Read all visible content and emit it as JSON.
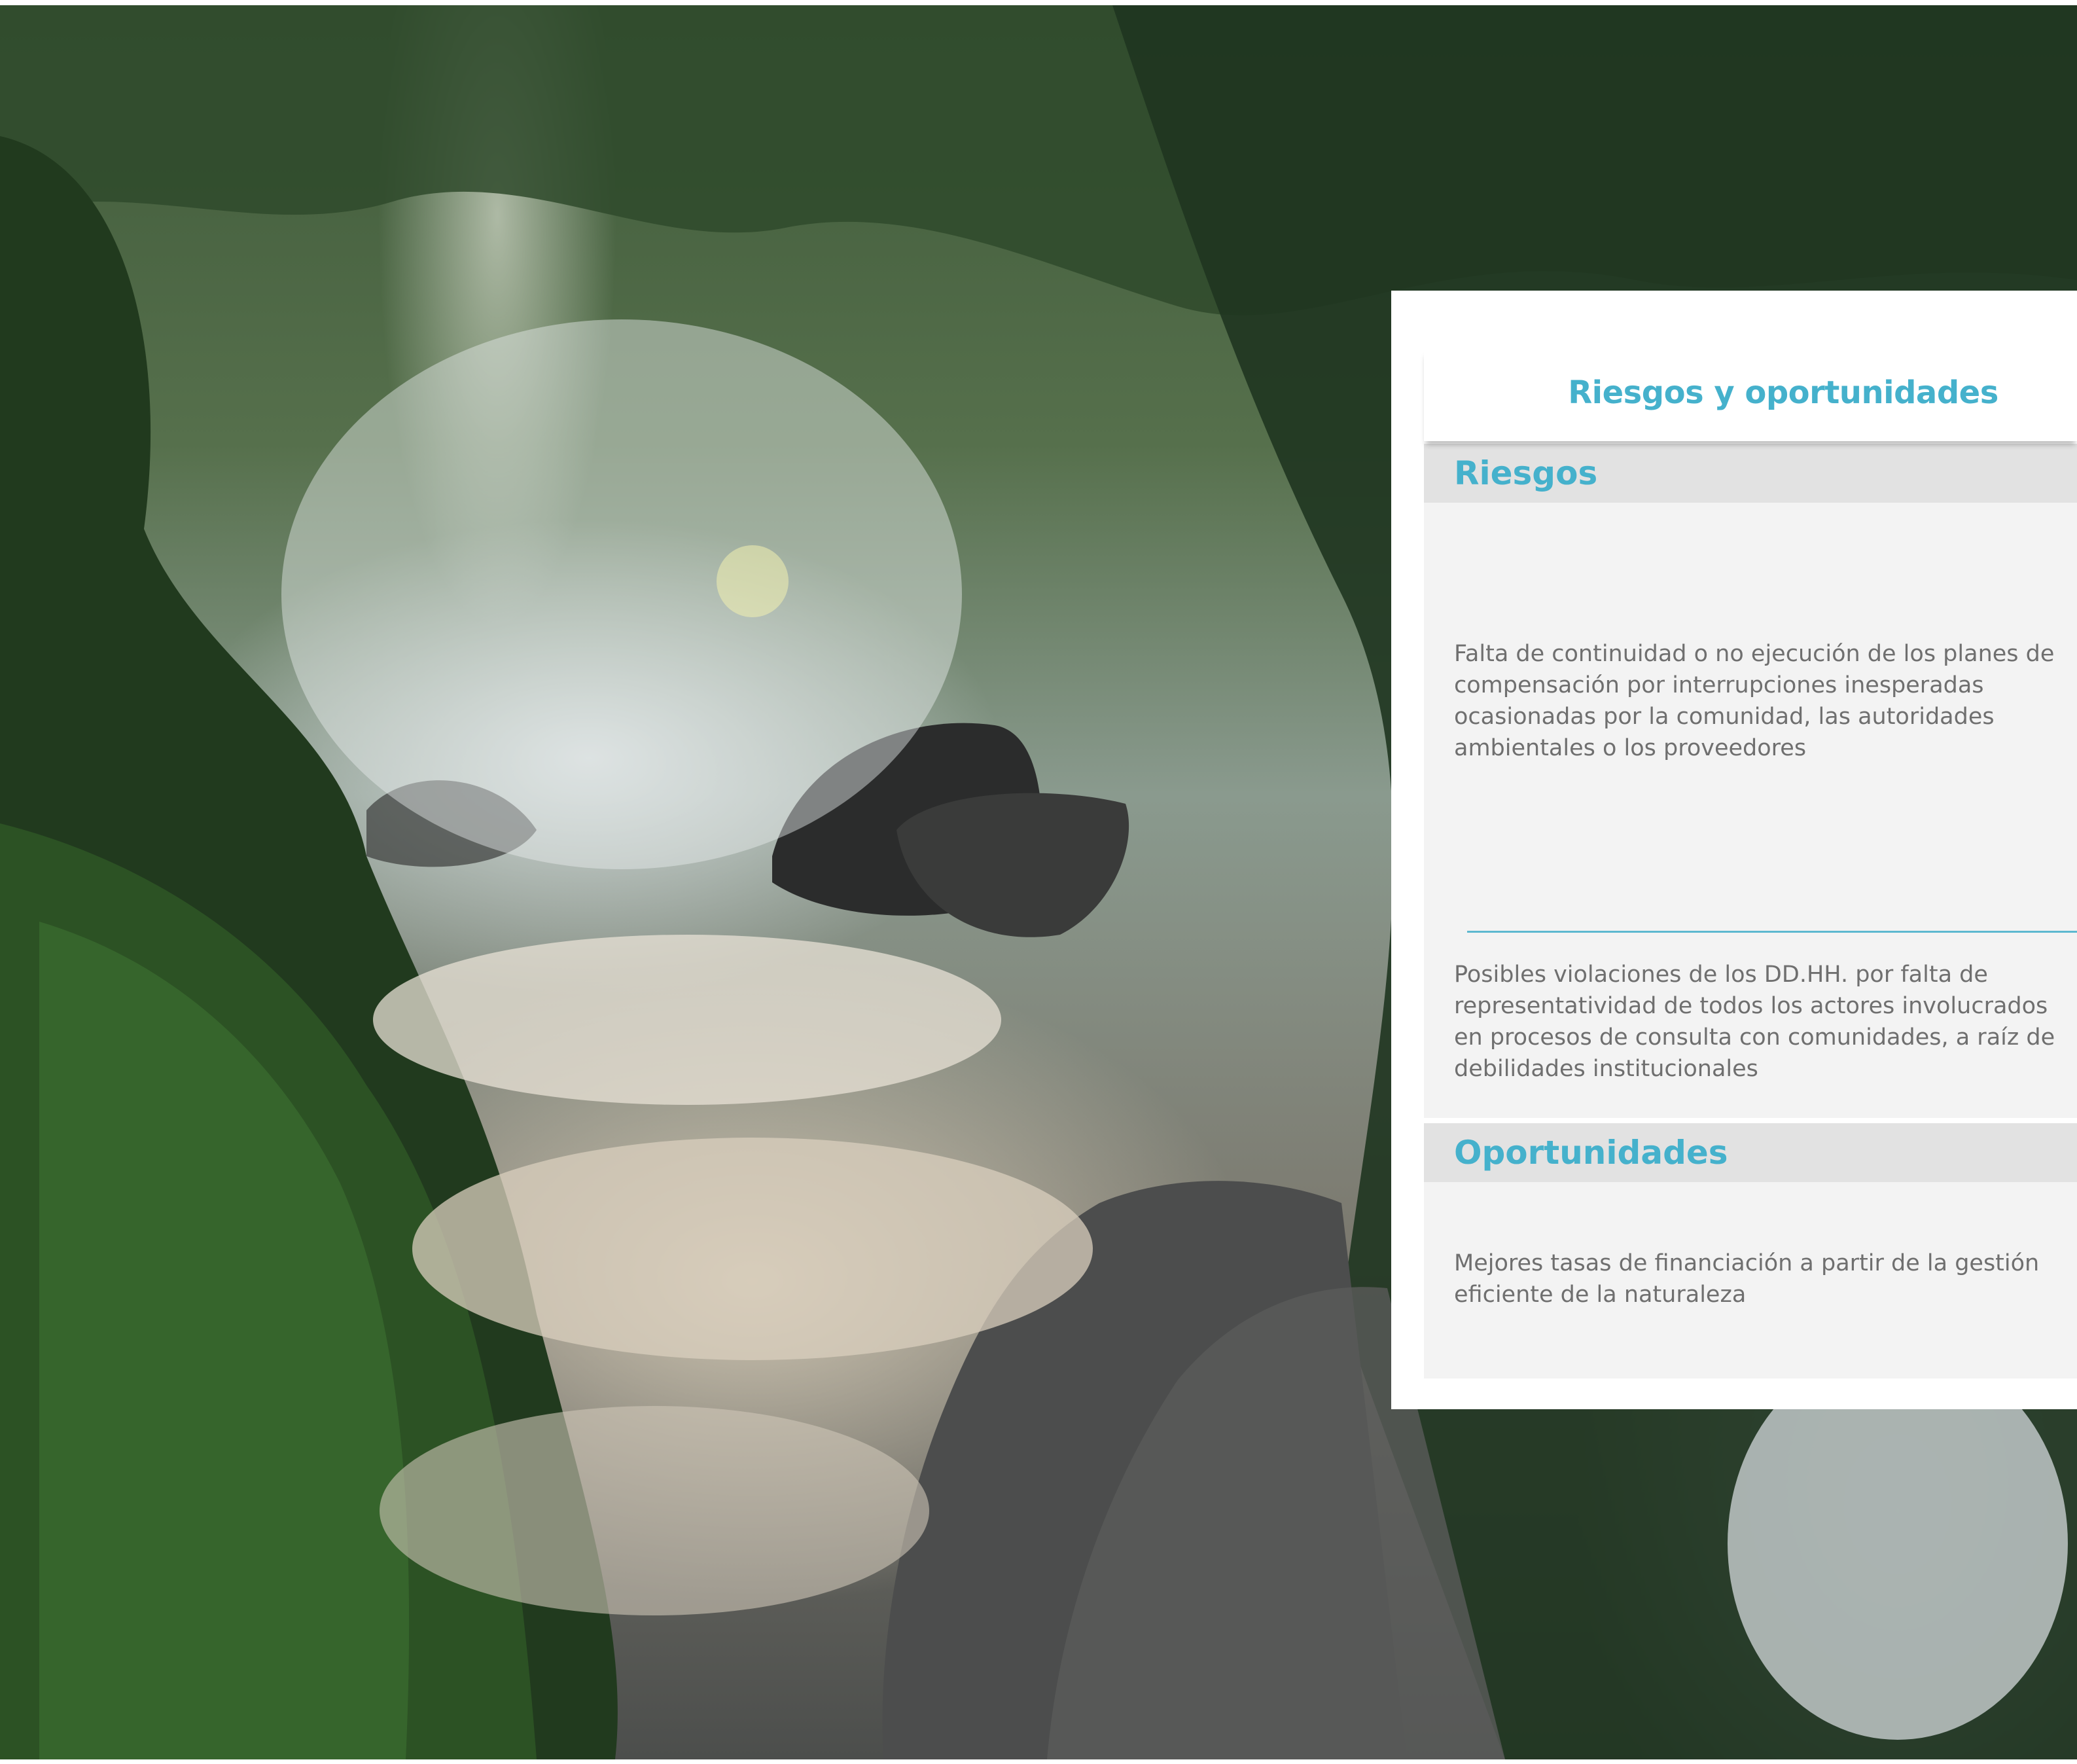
{
  "panel": {
    "title": "Riesgos y oportunidades",
    "sections": {
      "risks": {
        "heading": "Riesgos",
        "items": [
          "Falta de continuidad o no ejecución de los planes de compensación por interrupciones inesperadas ocasionadas por la comunidad, las autoridades ambientales o los proveedores",
          "Posibles violaciones de los DD.HH. por falta de representatividad de todos los actores involucrados en procesos de consulta con comunidades, a raíz de debilidades institucionales"
        ]
      },
      "opportunities": {
        "heading": "Oportunidades",
        "items": [
          "Mejores tasas de financiación a partir de la gestión eficiente de la naturaleza"
        ]
      }
    }
  },
  "colors": {
    "accent": "#45b1cc",
    "section_bar": "#e2e2e2",
    "body_bg": "#f3f3f3",
    "text": "#6f6f6f"
  }
}
